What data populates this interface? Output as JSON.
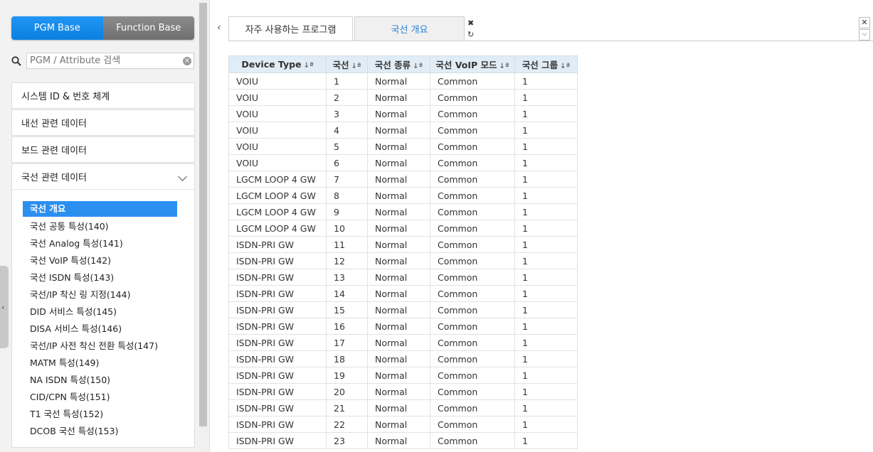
{
  "sidebar": {
    "toggle": {
      "pgm": "PGM Base",
      "function": "Function Base"
    },
    "search": {
      "placeholder": "PGM / Attribute 검색"
    },
    "menus": [
      "시스템 ID & 번호 체계",
      "내선 관련 데이터",
      "보드 관련 데이터",
      "국선 관련 데이터"
    ],
    "submenu": [
      "국선 개요",
      "국선 공통 특성(140)",
      "국선 Analog 특성(141)",
      "국선 VoIP 특성(142)",
      "국선 ISDN 특성(143)",
      "국선/IP 착신 링 지정(144)",
      "DID 서비스 특성(145)",
      "DISA 서비스 특성(146)",
      "국선/IP 사전 착신 전환 특성(147)",
      "MATM 특성(149)",
      "NA ISDN 특성(150)",
      "CID/CPN 특성(151)",
      "T1 국선 특성(152)",
      "DCOB 국선 특성(153)"
    ]
  },
  "tabs": [
    "자주 사용하는 프로그램",
    "국선 개요"
  ],
  "table": {
    "columns": [
      "Device Type",
      "국선",
      "국선 종류",
      "국선 VoIP 모드",
      "국선 그룹"
    ],
    "sort_glyph": "↓ª",
    "rows": [
      [
        "VOIU",
        "1",
        "Normal",
        "Common",
        "1"
      ],
      [
        "VOIU",
        "2",
        "Normal",
        "Common",
        "1"
      ],
      [
        "VOIU",
        "3",
        "Normal",
        "Common",
        "1"
      ],
      [
        "VOIU",
        "4",
        "Normal",
        "Common",
        "1"
      ],
      [
        "VOIU",
        "5",
        "Normal",
        "Common",
        "1"
      ],
      [
        "VOIU",
        "6",
        "Normal",
        "Common",
        "1"
      ],
      [
        "LGCM LOOP 4 GW",
        "7",
        "Normal",
        "Common",
        "1"
      ],
      [
        "LGCM LOOP 4 GW",
        "8",
        "Normal",
        "Common",
        "1"
      ],
      [
        "LGCM LOOP 4 GW",
        "9",
        "Normal",
        "Common",
        "1"
      ],
      [
        "LGCM LOOP 4 GW",
        "10",
        "Normal",
        "Common",
        "1"
      ],
      [
        "ISDN-PRI GW",
        "11",
        "Normal",
        "Common",
        "1"
      ],
      [
        "ISDN-PRI GW",
        "12",
        "Normal",
        "Common",
        "1"
      ],
      [
        "ISDN-PRI GW",
        "13",
        "Normal",
        "Common",
        "1"
      ],
      [
        "ISDN-PRI GW",
        "14",
        "Normal",
        "Common",
        "1"
      ],
      [
        "ISDN-PRI GW",
        "15",
        "Normal",
        "Common",
        "1"
      ],
      [
        "ISDN-PRI GW",
        "16",
        "Normal",
        "Common",
        "1"
      ],
      [
        "ISDN-PRI GW",
        "17",
        "Normal",
        "Common",
        "1"
      ],
      [
        "ISDN-PRI GW",
        "18",
        "Normal",
        "Common",
        "1"
      ],
      [
        "ISDN-PRI GW",
        "19",
        "Normal",
        "Common",
        "1"
      ],
      [
        "ISDN-PRI GW",
        "20",
        "Normal",
        "Common",
        "1"
      ],
      [
        "ISDN-PRI GW",
        "21",
        "Normal",
        "Common",
        "1"
      ],
      [
        "ISDN-PRI GW",
        "22",
        "Normal",
        "Common",
        "1"
      ],
      [
        "ISDN-PRI GW",
        "23",
        "Normal",
        "Common",
        "1"
      ]
    ]
  }
}
